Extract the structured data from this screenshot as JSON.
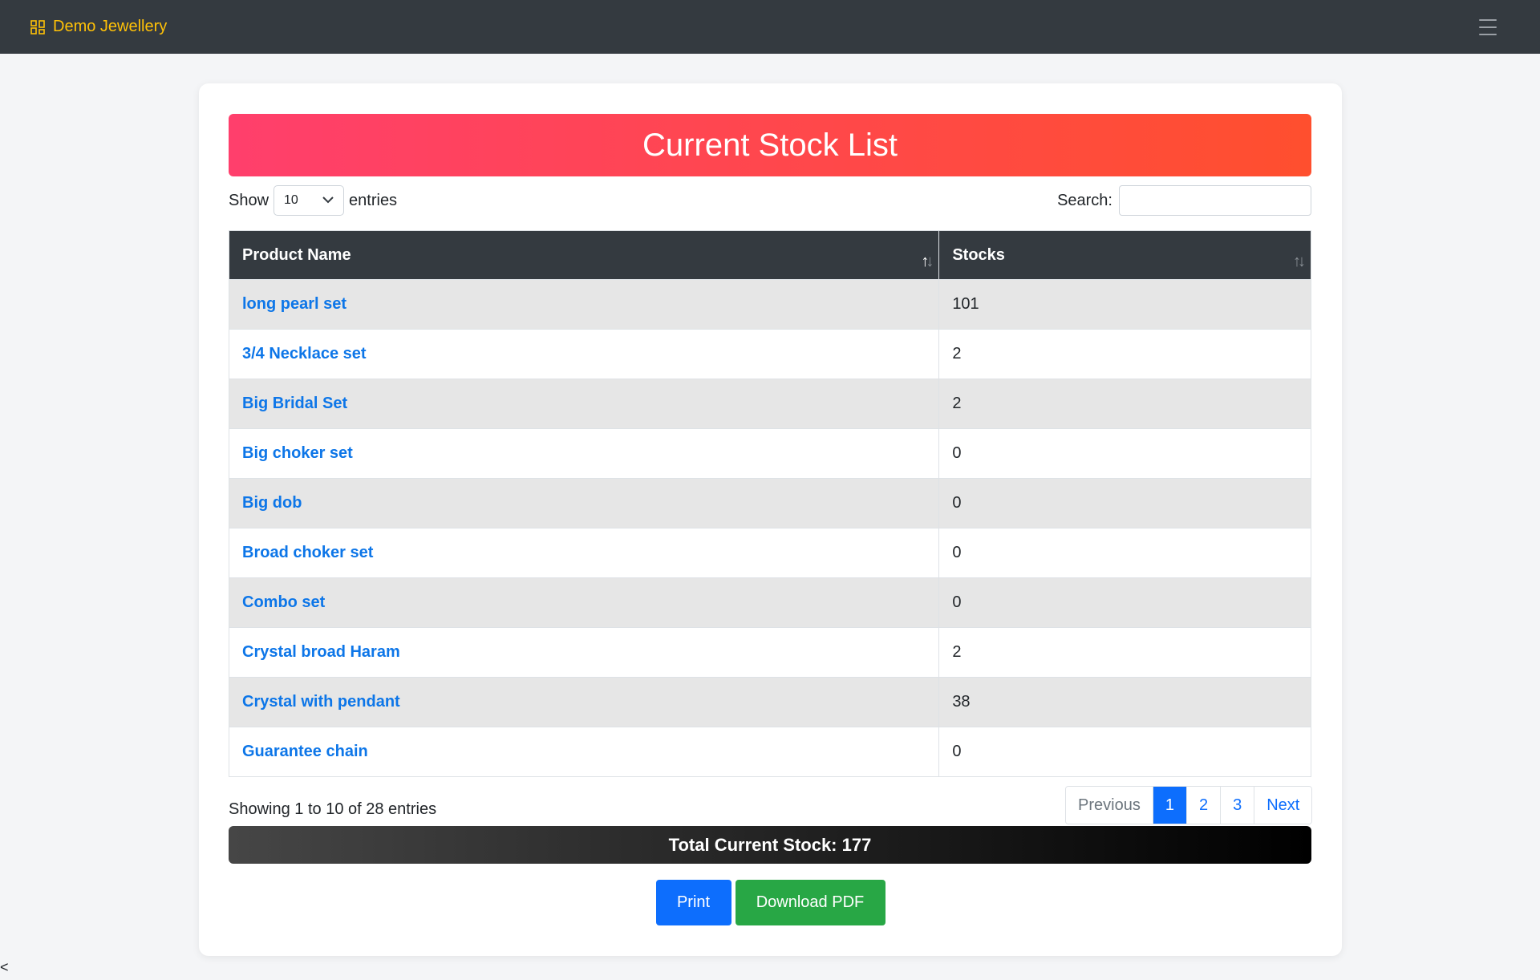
{
  "navbar": {
    "brand": "Demo Jewellery",
    "brand_icon": "grid-icon",
    "menu_icon": "hamburger-menu-icon",
    "brand_color": "#ffc107"
  },
  "header": {
    "title": "Current Stock List"
  },
  "controls": {
    "show_label": "Show",
    "entries_value": "10",
    "entries_label": "entries",
    "search_label": "Search:",
    "search_value": ""
  },
  "table": {
    "columns": [
      "Product Name",
      "Stocks"
    ],
    "rows": [
      {
        "name": "long pearl set",
        "stock": "101"
      },
      {
        "name": "3/4 Necklace set",
        "stock": "2"
      },
      {
        "name": "Big Bridal Set",
        "stock": "2"
      },
      {
        "name": "Big choker set",
        "stock": "0"
      },
      {
        "name": "Big dob",
        "stock": "0"
      },
      {
        "name": "Broad choker set",
        "stock": "0"
      },
      {
        "name": "Combo set",
        "stock": "0"
      },
      {
        "name": "Crystal broad Haram",
        "stock": "2"
      },
      {
        "name": "Crystal with pendant",
        "stock": "38"
      },
      {
        "name": "Guarantee chain",
        "stock": "0"
      }
    ]
  },
  "footer": {
    "info": "Showing 1 to 10 of 28 entries",
    "pagination": {
      "previous": "Previous",
      "pages": [
        "1",
        "2",
        "3"
      ],
      "active_page": "1",
      "next": "Next"
    },
    "total": "Total Current Stock: 177"
  },
  "actions": {
    "print": "Print",
    "download": "Download PDF"
  },
  "misc": {
    "corner_text": "<"
  },
  "colors": {
    "navbar": "#343a40",
    "banner_start": "#ff3f6c",
    "banner_end": "#ff4f2e",
    "link": "#0d6efd",
    "print": "#0d6efd",
    "download": "#28a745"
  }
}
